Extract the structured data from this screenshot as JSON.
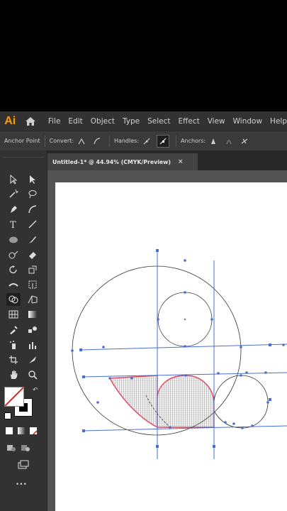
{
  "app": {
    "logo_text": "Ai"
  },
  "menu": [
    "File",
    "Edit",
    "Object",
    "Type",
    "Select",
    "Effect",
    "View",
    "Window",
    "Help"
  ],
  "options_bar": {
    "tool_label": "Anchor Point",
    "convert_label": "Convert:",
    "handles_label": "Handles:",
    "anchors_label": "Anchors:"
  },
  "document_tab": {
    "title": "Untitled-1* @ 44.94% (CMYK/Preview)",
    "close_label": "×"
  },
  "toolbar_misc": {
    "more_label": "•••"
  },
  "colors": {
    "background": "#000000",
    "ui_dark": "#323232",
    "pasteboard": "#535353",
    "selection_blue": "#4a6fcf",
    "shape_red": "#e0455f",
    "logo_orange": "#ff9a00"
  }
}
